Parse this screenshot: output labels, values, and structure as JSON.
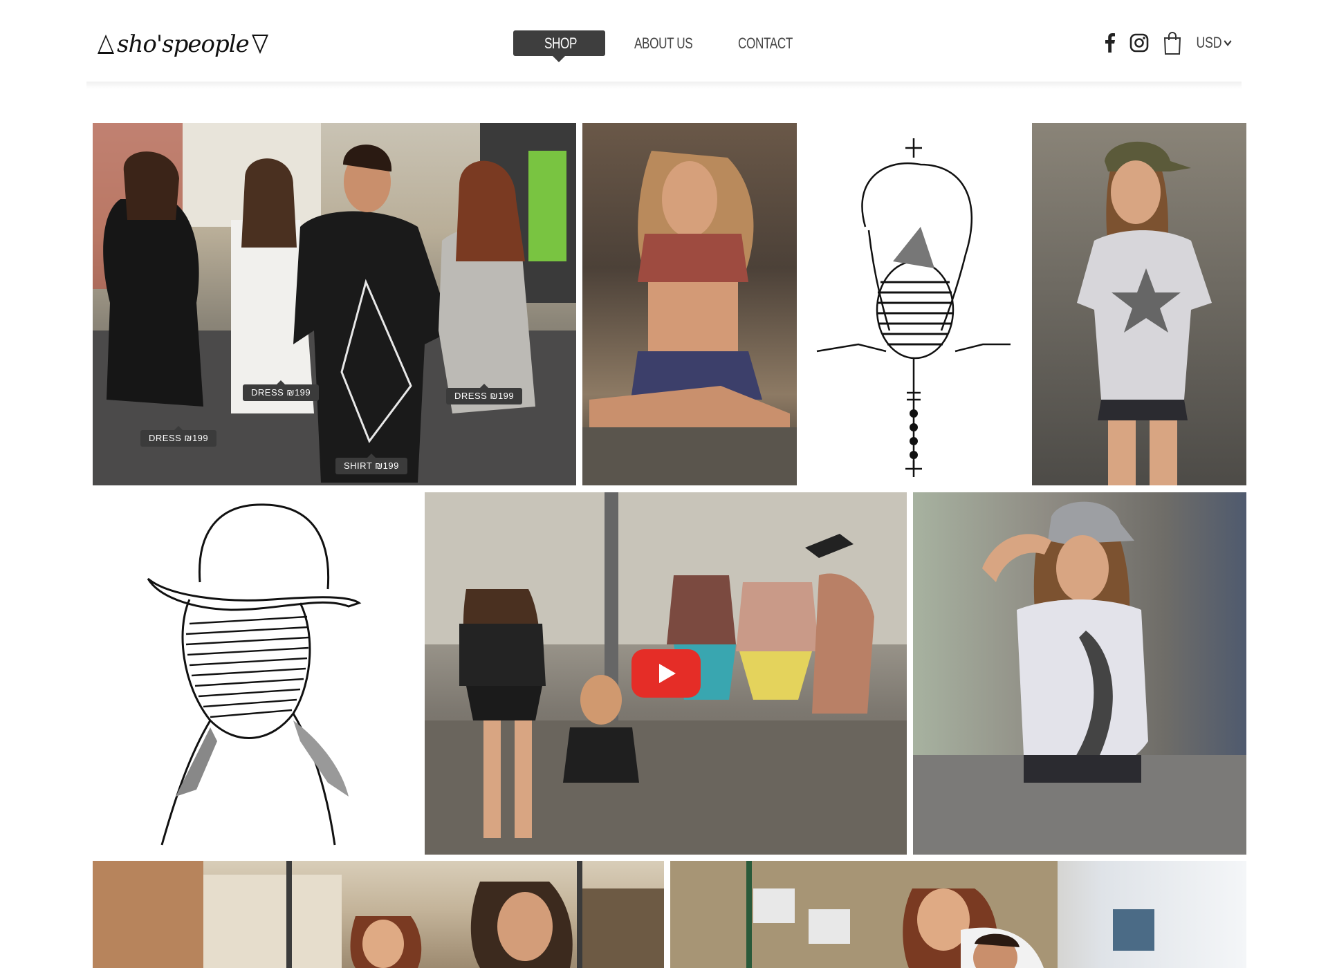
{
  "header": {
    "logo_text": "sho'speople",
    "nav": {
      "shop": "SHOP",
      "about": "ABOUT US",
      "contact": "CONTACT"
    },
    "currency": "USD",
    "icons": [
      "facebook-icon",
      "instagram-icon",
      "shopping-bag-icon",
      "chevron-down-icon"
    ]
  },
  "gallery": {
    "group_photo": {
      "tags": {
        "dress_left": "DRESS ₪199",
        "dress_mid": "DRESS ₪199",
        "shirt": "SHIRT ₪199",
        "dress_right": "DRESS ₪199"
      }
    },
    "video_tile": {
      "play_icon": "youtube-play-icon"
    }
  },
  "colors": {
    "nav_active_bg": "#3e3e3e",
    "youtube_red": "#e52d27"
  }
}
